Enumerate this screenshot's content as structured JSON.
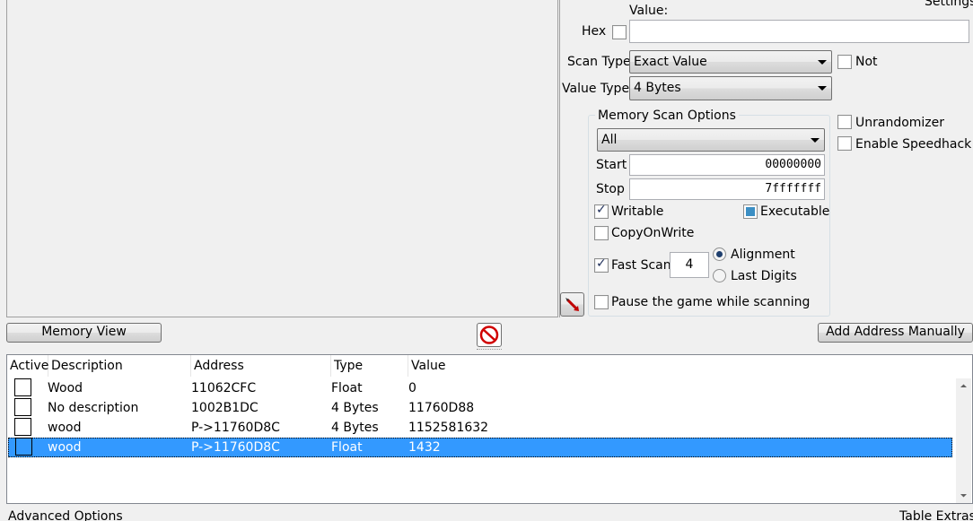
{
  "scan": {
    "settings_label": "Settings",
    "value_label": "Value:",
    "hex_label": "Hex",
    "hex_checked": false,
    "value_input": "",
    "scan_type_label": "Scan Type",
    "scan_type_value": "Exact Value",
    "not_label": "Not",
    "value_type_label": "Value Type",
    "value_type_value": "4 Bytes"
  },
  "memory_options": {
    "title": "Memory Scan Options",
    "region_value": "All",
    "start_label": "Start",
    "start_value": "00000000",
    "stop_label": "Stop",
    "stop_value": "7fffffff",
    "writable_label": "Writable",
    "executable_label": "Executable",
    "copy_on_write_label": "CopyOnWrite",
    "fast_scan_label": "Fast Scan",
    "fast_scan_value": "4",
    "alignment_label": "Alignment",
    "last_digits_label": "Last Digits",
    "pause_label": "Pause the game while scanning"
  },
  "extra_options": {
    "unrandomizer_label": "Unrandomizer",
    "speedhack_label": "Enable Speedhack"
  },
  "toolbar": {
    "memory_view_label": "Memory View",
    "add_address_label": "Add Address Manually"
  },
  "table": {
    "headers": {
      "active": "Active",
      "description": "Description",
      "address": "Address",
      "type": "Type",
      "value": "Value"
    },
    "rows": [
      {
        "description": "Wood",
        "address": "11062CFC",
        "type": "Float",
        "value": "0"
      },
      {
        "description": "No description",
        "address": "1002B1DC",
        "type": "4 Bytes",
        "value": "11760D88"
      },
      {
        "description": "wood",
        "address": "P->11760D8C",
        "type": "4 Bytes",
        "value": "1152581632"
      },
      {
        "description": "wood",
        "address": "P->11760D8C",
        "type": "Float",
        "value": "1432"
      }
    ]
  },
  "footer": {
    "advanced_label": "Advanced Options",
    "table_extras_label": "Table Extras"
  },
  "colors": {
    "selection": "#3399ff",
    "window_bg": "#f0f0f0"
  }
}
